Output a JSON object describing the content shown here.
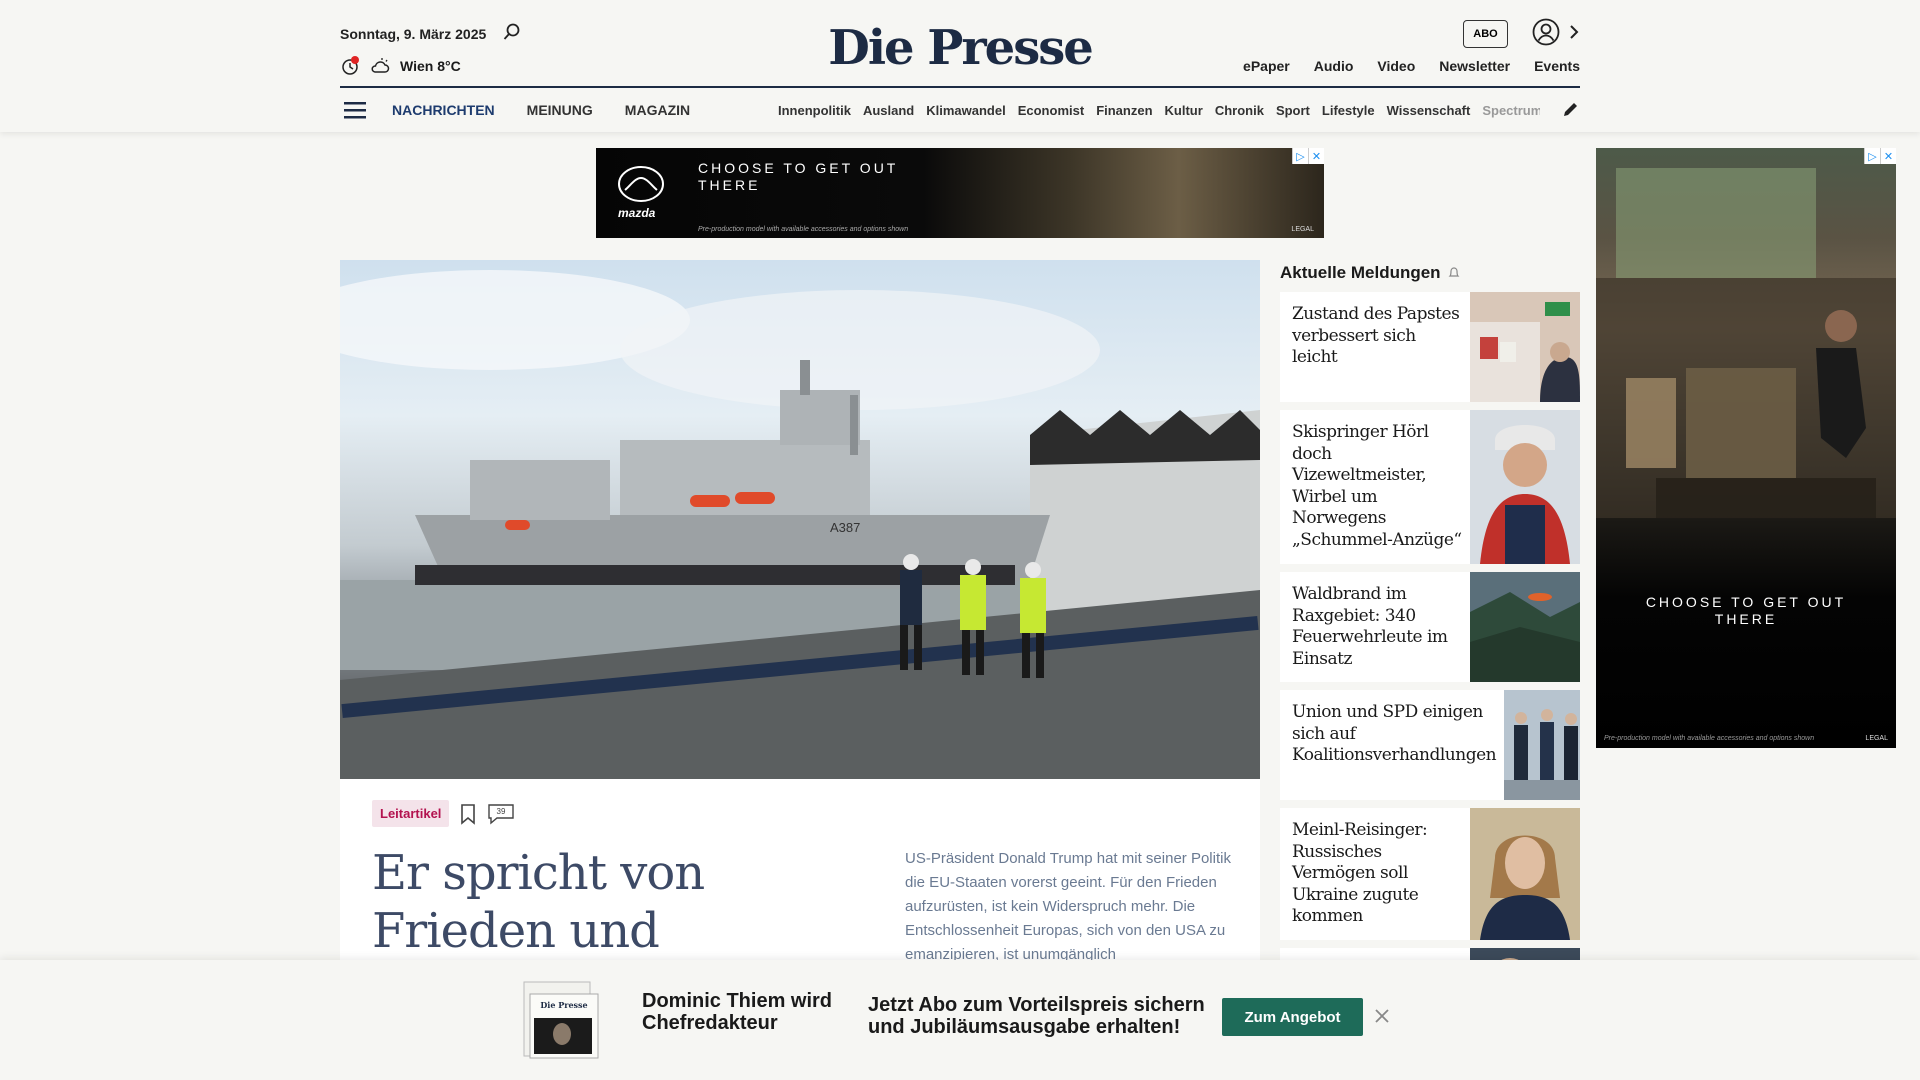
{
  "header": {
    "date": "Sonntag, 9. März 2025",
    "weather": "Wien 8°C",
    "logo": "Die Presse",
    "abo_label": "ABO",
    "util_links": [
      "ePaper",
      "Audio",
      "Video",
      "Newsletter",
      "Events"
    ]
  },
  "nav": {
    "main": [
      "NACHRICHTEN",
      "MEINUNG",
      "MAGAZIN"
    ],
    "sub": [
      "Innenpolitik",
      "Ausland",
      "Klimawandel",
      "Economist",
      "Finanzen",
      "Kultur",
      "Chronik",
      "Sport",
      "Lifestyle",
      "Wissenschaft",
      "Spectrum"
    ]
  },
  "ads": {
    "top": {
      "brand": "mazda",
      "tagline": "CHOOSE TO GET OUT THERE",
      "fine_print": "Pre-production model with available accessories and options shown",
      "legal": "LEGAL"
    },
    "side": {
      "tagline": "CHOOSE TO GET OUT THERE",
      "fine_print": "Pre-production model with available accessories and options shown",
      "legal": "LEGAL"
    }
  },
  "lead": {
    "category": "Leitartikel",
    "comment_count": "39",
    "headline": "Er spricht von Frieden und zertrümmert",
    "teaser": "US-Präsident Donald Trump hat mit seiner Politik die EU-Staaten vorerst geeint. Für den Frieden aufzurüsten, ist kein Widerspruch mehr. Die Entschlossenheit Europas, sich von den USA zu emanzipieren, ist unumgänglich",
    "image_text": "A387"
  },
  "sidebar": {
    "title": "Aktuelle Meldungen",
    "items": [
      {
        "headline": "Zustand des Papstes verbessert sich leicht"
      },
      {
        "headline": "Skispringer Hörl doch Vizeweltmeister, Wirbel um Norwegens „Schummel-Anzüge“"
      },
      {
        "headline": "Waldbrand im Raxgebiet: 340 Feuerwehrleute im Einsatz"
      },
      {
        "headline": "Union und SPD einigen sich auf Koalitionsverhandlungen"
      },
      {
        "headline": "Meinl-Reisinger: Russisches Vermögen soll Ukraine zugute kommen"
      }
    ]
  },
  "promo": {
    "name": "Dominic Thiem wird Chefredakteur",
    "text": "Jetzt Abo zum Vorteilspreis sichern und Jubiläumsausgabe erhalten!",
    "button": "Zum Angebot",
    "paper_logo": "Die Presse"
  }
}
